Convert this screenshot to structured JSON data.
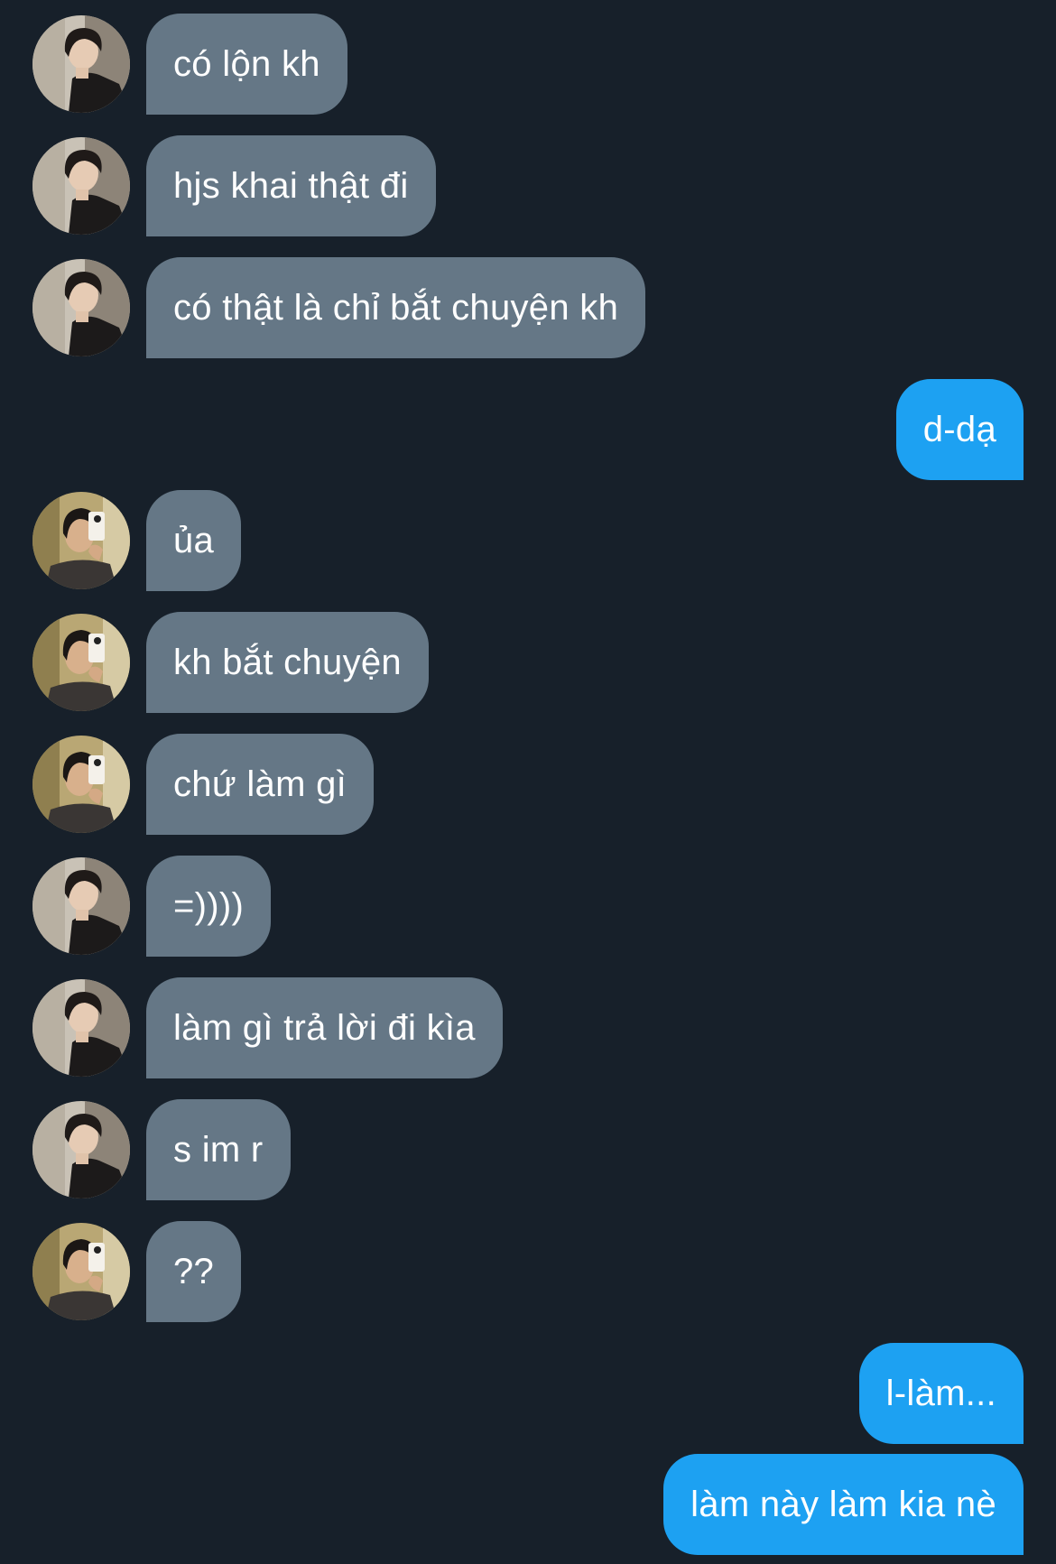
{
  "messages": [
    {
      "sender": "them",
      "avatar": "avatar-a",
      "text": "có lộn kh"
    },
    {
      "sender": "them",
      "avatar": "avatar-a",
      "text": "hjs khai thật đi"
    },
    {
      "sender": "them",
      "avatar": "avatar-a",
      "text": "có thật là chỉ bắt chuyện kh"
    },
    {
      "sender": "me",
      "text": "d-dạ"
    },
    {
      "sender": "them",
      "avatar": "avatar-b",
      "text": "ủa"
    },
    {
      "sender": "them",
      "avatar": "avatar-b",
      "text": "kh bắt chuyện"
    },
    {
      "sender": "them",
      "avatar": "avatar-b",
      "text": "chứ làm gì"
    },
    {
      "sender": "them",
      "avatar": "avatar-a",
      "text": "=))))"
    },
    {
      "sender": "them",
      "avatar": "avatar-a",
      "text": "làm gì trả lời đi kìa"
    },
    {
      "sender": "them",
      "avatar": "avatar-a",
      "text": "s im r"
    },
    {
      "sender": "them",
      "avatar": "avatar-b",
      "text": "??"
    },
    {
      "sender": "me",
      "text": "l-làm..."
    },
    {
      "sender": "me",
      "text": "làm này làm kia nè"
    }
  ],
  "colors": {
    "background": "#17202a",
    "incoming_bubble": "#657786",
    "outgoing_bubble": "#1da1f2",
    "text": "#ffffff"
  }
}
